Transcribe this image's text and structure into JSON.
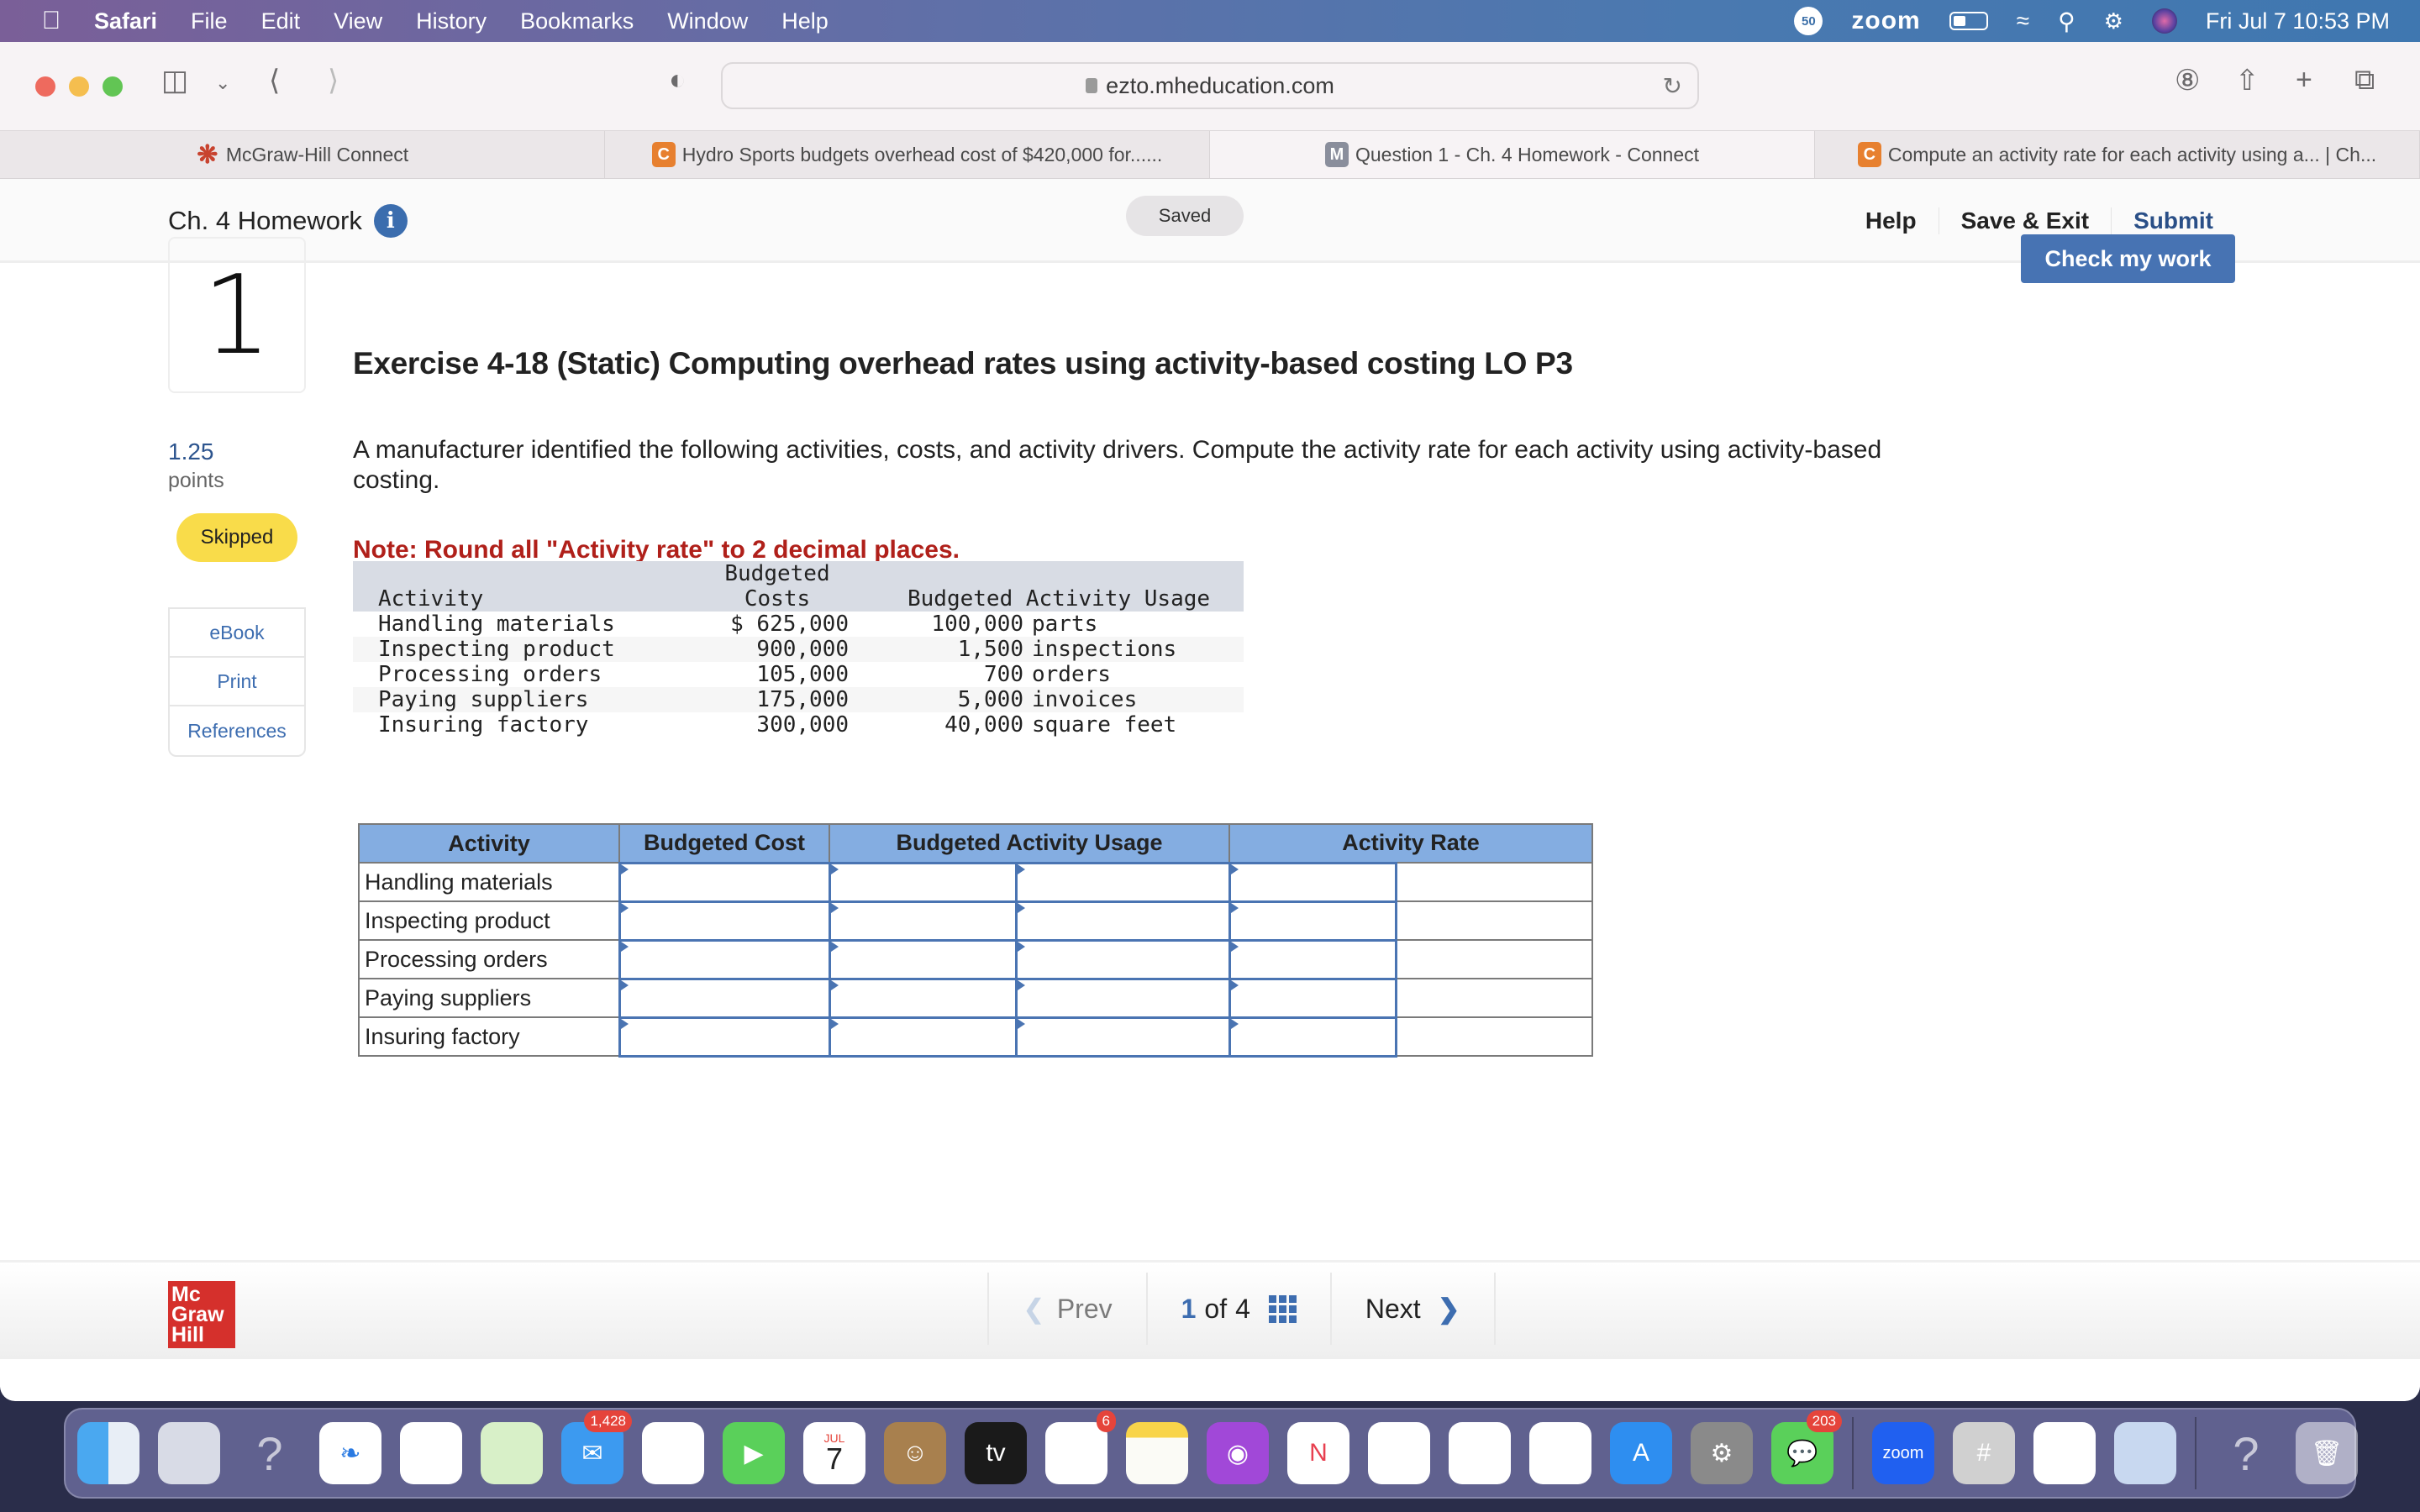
{
  "menubar": {
    "app": "Safari",
    "items": [
      "File",
      "Edit",
      "View",
      "History",
      "Bookmarks",
      "Window",
      "Help"
    ],
    "status": {
      "badge": "50",
      "zoom": "zoom",
      "datetime": "Fri Jul 7  10:53 PM"
    }
  },
  "browser": {
    "url": "ezto.mheducation.com",
    "tabs": [
      {
        "label": "McGraw-Hill Connect",
        "favicon": "mcgraw-hill-icon",
        "active": false
      },
      {
        "label": "Hydro Sports budgets overhead cost of $420,000 for......",
        "favicon": "C",
        "active": false
      },
      {
        "label": "Question 1 - Ch. 4 Homework - Connect",
        "favicon": "M",
        "active": true
      },
      {
        "label": "Compute an activity rate for each activity using a... | Ch...",
        "favicon": "C",
        "active": false
      }
    ]
  },
  "header": {
    "title": "Ch. 4 Homework",
    "info_icon": "i",
    "status": "Saved",
    "links": {
      "help": "Help",
      "save_exit": "Save & Exit",
      "submit": "Submit"
    }
  },
  "question": {
    "number": "1",
    "check_button": "Check my work",
    "title": "Exercise 4-18 (Static) Computing overhead rates using activity-based costing LO P3",
    "points_value": "1.25",
    "points_label": "points",
    "status_badge": "Skipped",
    "side_links": [
      "eBook",
      "Print",
      "References"
    ],
    "prompt": "A manufacturer identified the following activities, costs, and activity drivers. Compute the activity rate for each activity using activity-based costing.",
    "note": "Note: Round all \"Activity rate\" to 2 decimal places."
  },
  "given_table": {
    "headers": {
      "activity": "Activity",
      "costs_line1": "Budgeted",
      "costs_line2": "Costs",
      "usage": "Budgeted Activity Usage"
    },
    "rows": [
      {
        "activity": "Handling materials",
        "cost": "$ 625,000",
        "usage": "100,000",
        "unit": "parts"
      },
      {
        "activity": "Inspecting product",
        "cost": "900,000",
        "usage": "1,500",
        "unit": "inspections"
      },
      {
        "activity": "Processing orders",
        "cost": "105,000",
        "usage": "700",
        "unit": "orders"
      },
      {
        "activity": "Paying suppliers",
        "cost": "175,000",
        "usage": "5,000",
        "unit": "invoices"
      },
      {
        "activity": "Insuring factory",
        "cost": "300,000",
        "usage": "40,000",
        "unit": "square feet"
      }
    ]
  },
  "answer_table": {
    "headers": [
      "Activity",
      "Budgeted Cost",
      "Budgeted Activity Usage",
      "Activity Rate"
    ],
    "rows": [
      {
        "activity": "Handling materials",
        "cost": "",
        "usage": "",
        "usage_unit": "",
        "rate": "",
        "rate_unit": ""
      },
      {
        "activity": "Inspecting product",
        "cost": "",
        "usage": "",
        "usage_unit": "",
        "rate": "",
        "rate_unit": ""
      },
      {
        "activity": "Processing orders",
        "cost": "",
        "usage": "",
        "usage_unit": "",
        "rate": "",
        "rate_unit": ""
      },
      {
        "activity": "Paying suppliers",
        "cost": "",
        "usage": "",
        "usage_unit": "",
        "rate": "",
        "rate_unit": ""
      },
      {
        "activity": "Insuring factory",
        "cost": "",
        "usage": "",
        "usage_unit": "",
        "rate": "",
        "rate_unit": ""
      }
    ]
  },
  "footer": {
    "logo": "Mc Graw Hill",
    "prev": "Prev",
    "current_page": "1",
    "of_label": "of",
    "total_pages": "4",
    "next": "Next"
  },
  "dock": {
    "apps": [
      {
        "name": "finder",
        "badge": null
      },
      {
        "name": "launchpad",
        "badge": null
      },
      {
        "name": "unknown-app",
        "badge": null
      },
      {
        "name": "safari",
        "badge": null
      },
      {
        "name": "chrome",
        "badge": null
      },
      {
        "name": "maps",
        "badge": null
      },
      {
        "name": "mail",
        "badge": "1,428"
      },
      {
        "name": "photos",
        "badge": null
      },
      {
        "name": "facetime",
        "badge": null
      },
      {
        "name": "calendar",
        "badge": null,
        "month": "JUL",
        "day": "7"
      },
      {
        "name": "contacts",
        "badge": null
      },
      {
        "name": "apple-tv",
        "badge": null,
        "label": "tv"
      },
      {
        "name": "reminders",
        "badge": "6"
      },
      {
        "name": "notes",
        "badge": null
      },
      {
        "name": "podcasts",
        "badge": null
      },
      {
        "name": "news",
        "badge": null
      },
      {
        "name": "keynote",
        "badge": null
      },
      {
        "name": "numbers",
        "badge": null
      },
      {
        "name": "pages",
        "badge": null
      },
      {
        "name": "app-store",
        "badge": null
      },
      {
        "name": "system-preferences",
        "badge": null
      },
      {
        "name": "messages",
        "badge": "203"
      },
      {
        "name": "zoom",
        "badge": null,
        "label": "zoom"
      },
      {
        "name": "calculator",
        "badge": null
      },
      {
        "name": "telegram",
        "badge": null
      },
      {
        "name": "preview",
        "badge": null
      },
      {
        "name": "unknown-app-2",
        "badge": null
      },
      {
        "name": "trash",
        "badge": null
      }
    ]
  }
}
